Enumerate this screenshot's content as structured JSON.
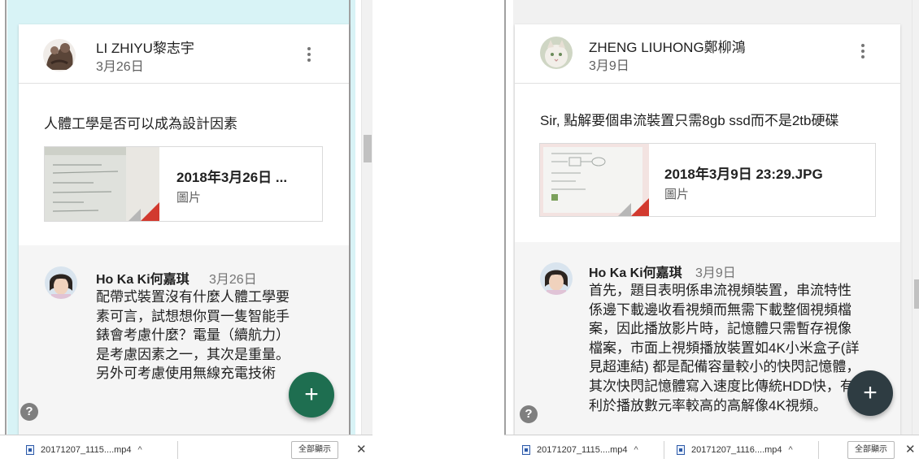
{
  "left": {
    "post": {
      "author": "LI ZHIYU黎志宇",
      "date": "3月26日",
      "text": "人體工學是否可以成為設計因素",
      "attachment": {
        "name": "2018年3月26日 ...",
        "type": "圖片"
      }
    },
    "comment": {
      "author": "Ho Ka Ki何嘉琪",
      "date": "3月26日",
      "lines": [
        "配帶式裝置沒有什麼人體工學要",
        "素可言，試想想你買一隻智能手",
        "錶會考慮什麼？電量（續航力）",
        "是考慮因素之一，其次是重量。",
        "另外可考慮使用無線充電技術"
      ]
    },
    "help_label": "?",
    "fab_label": "+",
    "downloads": [
      {
        "name": "20171207_1115....mp4"
      }
    ],
    "show_all_label": "全部顯示",
    "close_label": "✕",
    "chevron": "^"
  },
  "right": {
    "post": {
      "author": "ZHENG LIUHONG鄭柳鴻",
      "date": "3月9日",
      "text": "Sir, 點解要個串流裝置只需8gb ssd而不是2tb硬碟",
      "attachment": {
        "name": "2018年3月9日 23:29.JPG",
        "type": "圖片"
      }
    },
    "comment": {
      "author": "Ho Ka Ki何嘉琪",
      "date": "3月9日",
      "lines": [
        "首先，題目表明係串流視頻裝置，串流特性",
        "係邊下載邊收看視頻而無需下載整個視頻檔",
        "案，因此播放影片時，記憶體只需暫存視像",
        "檔案，市面上視頻播放裝置如4K小米盒子(詳",
        "見超連結) 都是配備容量較小的快閃記憶體，",
        "其次快閃記憶體寫入速度比傳統HDD快，有",
        "利於播放數元率較高的高解像4K視頻。"
      ]
    },
    "help_label": "?",
    "fab_label": "+",
    "downloads": [
      {
        "name": "20171207_1115....mp4"
      },
      {
        "name": "20171207_1116....mp4"
      }
    ],
    "show_all_label": "全部顯示",
    "close_label": "✕",
    "chevron": "^"
  }
}
